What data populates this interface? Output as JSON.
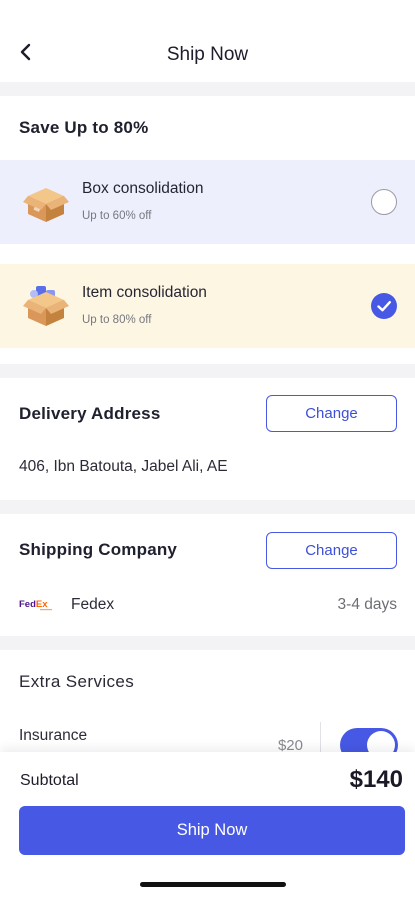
{
  "header": {
    "title": "Ship Now",
    "back_icon": "chevron-left-icon"
  },
  "consolidation": {
    "title": "Save Up to 80%",
    "options": [
      {
        "name": "Box consolidation",
        "sub": "Up to 60% off",
        "selected": false,
        "bg": "#eeeffc"
      },
      {
        "name": "Item consolidation",
        "sub": "Up to 80% off",
        "selected": true,
        "bg": "#fdf6e3"
      }
    ]
  },
  "delivery": {
    "title": "Delivery Address",
    "change_label": "Change",
    "address": "406, Ibn Batouta, Jabel Ali, AE"
  },
  "shipping": {
    "title": "Shipping Company",
    "change_label": "Change",
    "carrier": "Fedex",
    "logo_text": "FedEx",
    "duration": "3-4 days"
  },
  "extras": {
    "title": "Extra Services",
    "insurance_label": "Insurance",
    "insurance_price": "$20",
    "insurance_enabled": true
  },
  "footer": {
    "subtotal_label": "Subtotal",
    "subtotal_value": "$140",
    "ship_button": "Ship Now"
  },
  "colors": {
    "accent": "#4759e4",
    "box_option_bg": "#eeeffc",
    "item_option_bg": "#fdf6e3"
  }
}
